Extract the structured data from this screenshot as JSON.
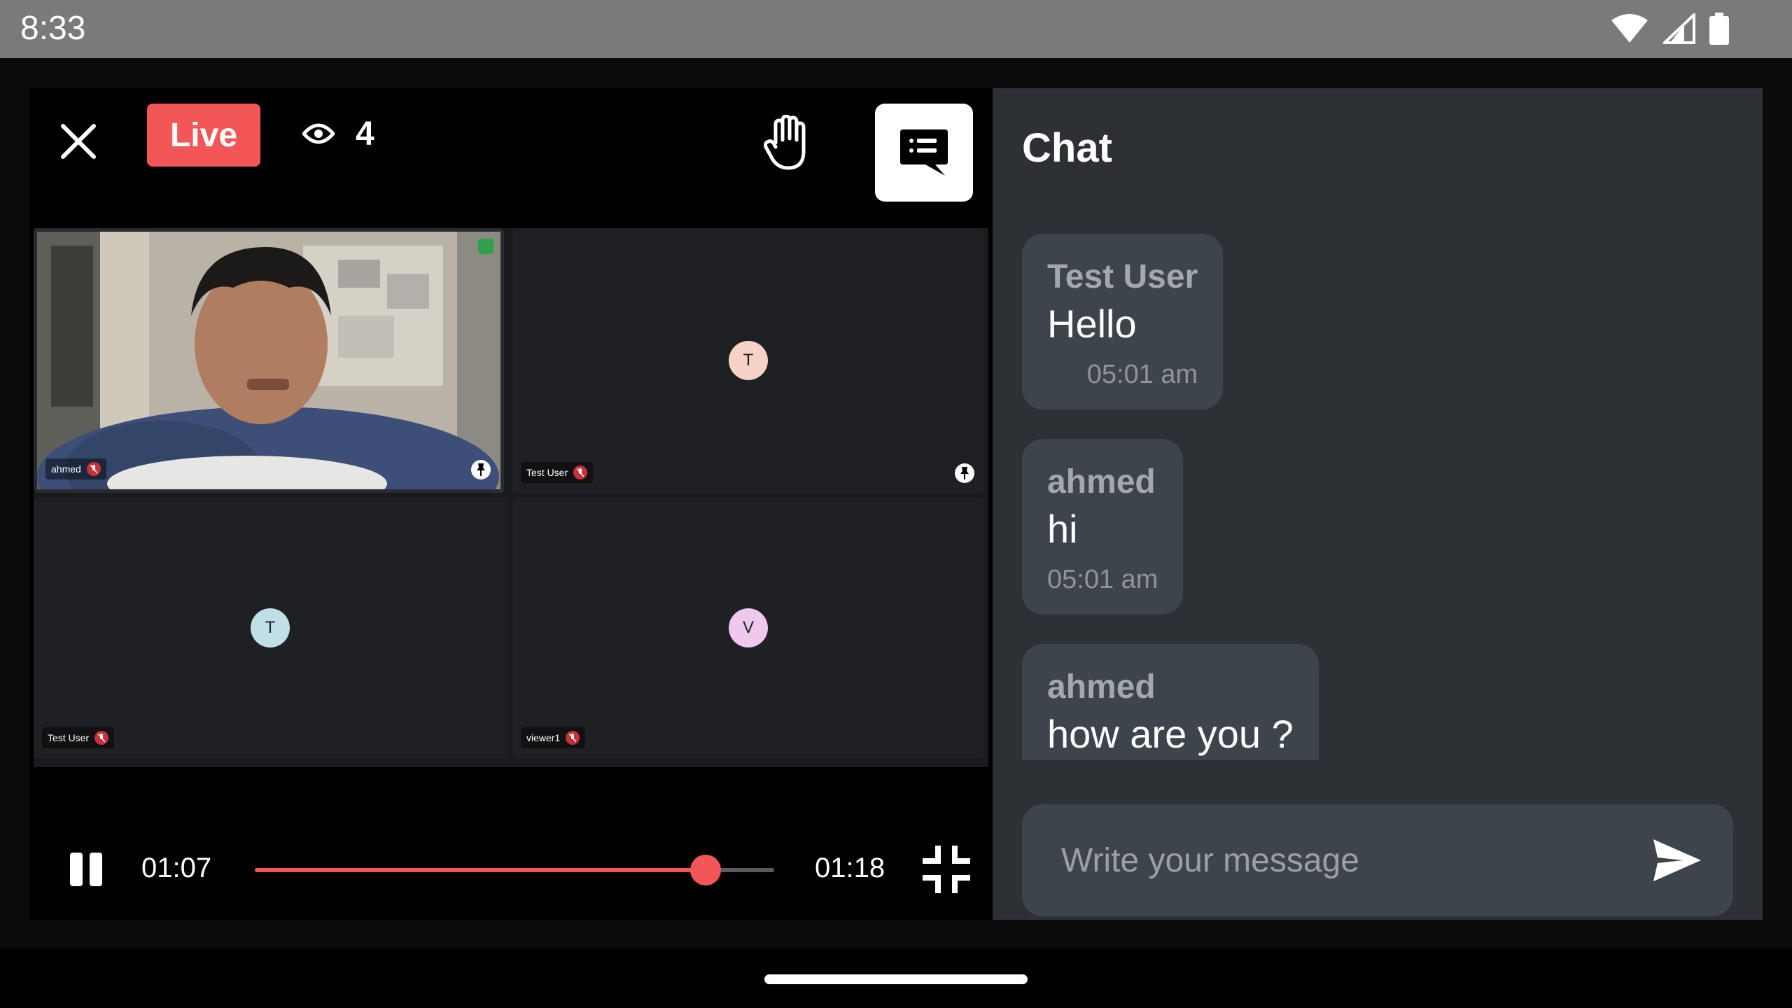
{
  "status_bar": {
    "time": "8:33"
  },
  "header": {
    "live_label": "Live",
    "viewer_count": "4"
  },
  "participants": [
    {
      "name": "ahmed",
      "has_video": true
    },
    {
      "name": "Test User",
      "initial": "T",
      "avatar_color": "#f6d3c6"
    },
    {
      "name": "Test User",
      "initial": "T",
      "avatar_color": "#bfe0e7"
    },
    {
      "name": "viewer1",
      "initial": "V",
      "avatar_color": "#efc8ef"
    }
  ],
  "player": {
    "current_time": "01:07",
    "total_time": "01:18",
    "progress": 0.868
  },
  "chat": {
    "title": "Chat",
    "messages": [
      {
        "sender": "Test User",
        "text": "Hello",
        "time": "05:01 am"
      },
      {
        "sender": "ahmed",
        "text": "hi",
        "time": "05:01 am"
      },
      {
        "sender": "ahmed",
        "text": "how are you ?",
        "time": ""
      }
    ],
    "input_placeholder": "Write your message"
  },
  "colors": {
    "accent": "#f25656",
    "chat_bg": "#2d3035",
    "bubble_bg": "#3e444c"
  }
}
